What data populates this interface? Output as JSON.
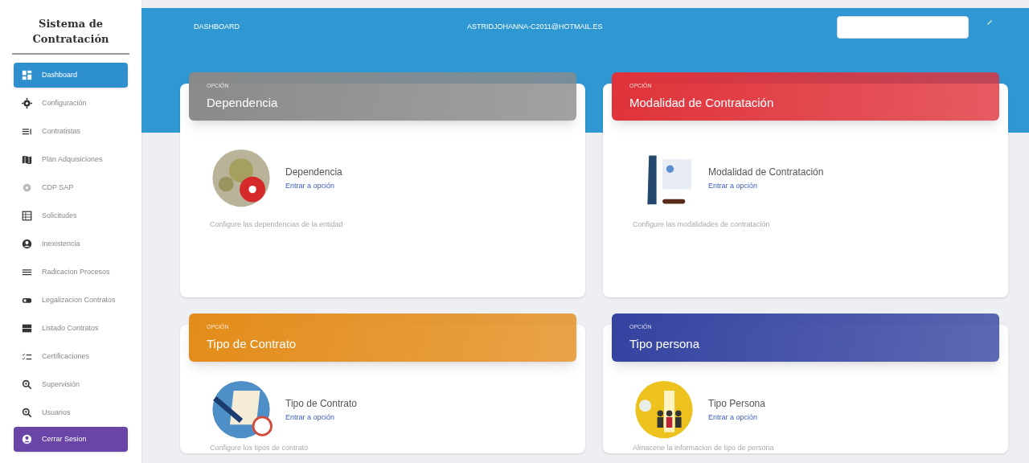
{
  "sidebar": {
    "title": "Sistema de Contratación",
    "items": [
      {
        "label": "Dashboard",
        "selected": true
      },
      {
        "label": "Configuración",
        "selected": false
      },
      {
        "label": "Contratistas",
        "selected": false
      },
      {
        "label": "Plan Adquisiciones",
        "selected": false
      },
      {
        "label": "CDP SAP",
        "selected": false
      },
      {
        "label": "Solicitudes",
        "selected": false
      },
      {
        "label": "Inexistencia",
        "selected": false
      },
      {
        "label": "Radicacion Procesos",
        "selected": false
      },
      {
        "label": "Legalizacion Contratos",
        "selected": false
      },
      {
        "label": "Listado Contratos",
        "selected": false
      },
      {
        "label": "Certificaciones",
        "selected": false
      },
      {
        "label": "Supervisión",
        "selected": false
      },
      {
        "label": "Usuarios",
        "selected": false
      }
    ],
    "logout_button": {
      "label": "Cerrar Sesion"
    }
  },
  "header": {
    "title": "DASHBOARD",
    "user": "ASTRIDJOHANNA-C2011@HOTMAIL.ES"
  },
  "cards": [
    {
      "eyebrow": "OPCIÓN",
      "title": "Dependencia",
      "color": "#8a8a8a",
      "name": "Dependencia",
      "link": "Entrar a opción",
      "description": "Configure las dependencias de la entidad"
    },
    {
      "eyebrow": "OPCIÓN",
      "title": "Modalidad de Contratación",
      "color": "#e0323a",
      "name": "Modalidad de Contratación",
      "link": "Entrar a opción",
      "description": "Configure las modalidades de contratación"
    },
    {
      "eyebrow": "OPCIÓN",
      "title": "Tipo de Contrato",
      "color": "#e38c1a",
      "name": "Tipo de Contrato",
      "link": "Entrar a opción",
      "description": "Configure los tipos de contrato"
    },
    {
      "eyebrow": "OPCIÓN",
      "title": "Tipo persona",
      "color": "#3443a0",
      "name": "Tipo Persona",
      "link": "Entrar a opción",
      "description": "Almacene la informacion de tipo de persona"
    }
  ]
}
